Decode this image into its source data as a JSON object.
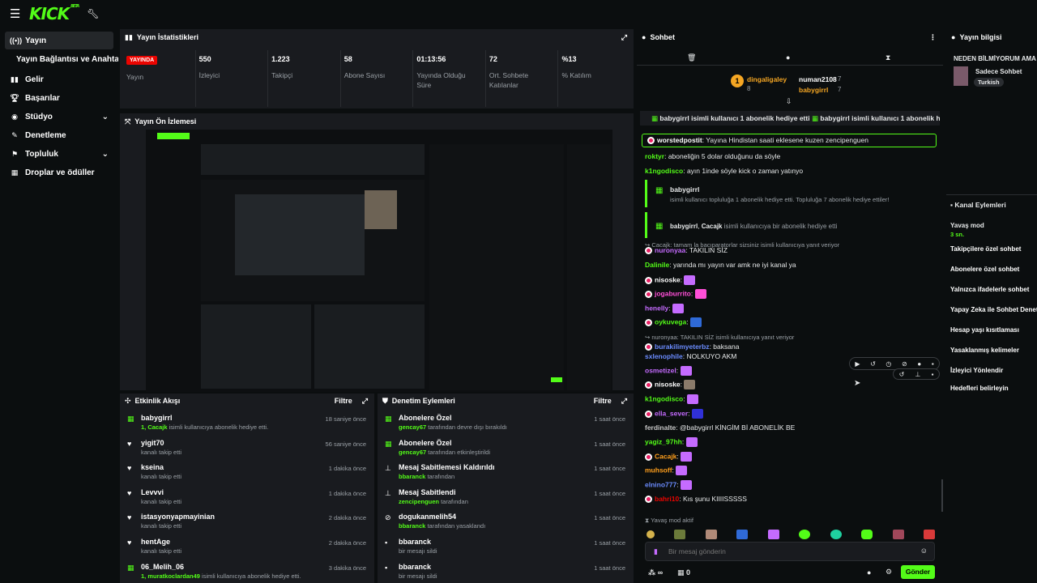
{
  "brand": {
    "logo": "KICK",
    "logo_sup": "BETA"
  },
  "sidebar": {
    "items": [
      {
        "label": "Yayın",
        "icon": "broadcast-icon"
      },
      {
        "label": "Yayın Bağlantısı ve Anahtarı"
      },
      {
        "label": "Gelir",
        "icon": "chart-icon"
      },
      {
        "label": "Başarılar",
        "icon": "trophy-icon"
      },
      {
        "label": "Stüdyo",
        "icon": "studio-icon"
      },
      {
        "label": "Denetleme",
        "icon": "wrench-icon"
      },
      {
        "label": "Topluluk",
        "icon": "community-icon"
      },
      {
        "label": "Droplar ve ödüller",
        "icon": "gift-icon"
      }
    ]
  },
  "stats_panel": {
    "title": "Yayın İstatistikleri",
    "live_label": "YAYINDA",
    "stats": [
      {
        "value": "",
        "label": "Yayın"
      },
      {
        "value": "550",
        "label": "İzleyici"
      },
      {
        "value": "1.223",
        "label": "Takipçi"
      },
      {
        "value": "58",
        "label": "Abone Sayısı"
      },
      {
        "value": "01:13:56",
        "label": "Yayında Olduğu Süre"
      },
      {
        "value": "72",
        "label": "Ort. Sohbete Katılanlar"
      },
      {
        "value": "%13",
        "label": "% Katılım"
      }
    ]
  },
  "preview_panel": {
    "title": "Yayın Ön İzlemesi"
  },
  "activity": {
    "title": "Etkinlik Akışı",
    "filter": "Filtre",
    "rows": [
      {
        "name": "babygirrl",
        "sub_user": "1, Cacajk",
        "sub": " isimli kullanıcıya abonelik hediye etti.",
        "time": "18 saniye önce",
        "icon": "gift"
      },
      {
        "name": "yigit70",
        "sub_user": "",
        "sub": "kanalı takip etti",
        "time": "56 saniye önce",
        "icon": "heart"
      },
      {
        "name": "kseina",
        "sub_user": "",
        "sub": "kanalı takip etti",
        "time": "1 dakika önce",
        "icon": "heart"
      },
      {
        "name": "Levvvi",
        "sub_user": "",
        "sub": "kanalı takip etti",
        "time": "1 dakika önce",
        "icon": "heart"
      },
      {
        "name": "istasyonyapmayinian",
        "sub_user": "",
        "sub": "kanalı takip etti",
        "time": "2 dakika önce",
        "icon": "heart"
      },
      {
        "name": "hentAge",
        "sub_user": "",
        "sub": "kanalı takip etti",
        "time": "2 dakika önce",
        "icon": "heart"
      },
      {
        "name": "06_Melih_06",
        "sub_user": "1, muratkoclardan49",
        "sub": " isimli kullanıcıya abonelik hediye etti.",
        "time": "3 dakika önce",
        "icon": "gift"
      }
    ]
  },
  "moderation": {
    "title": "Denetim Eylemleri",
    "filter": "Filtre",
    "rows": [
      {
        "name": "Abonelere Özel",
        "sub_user": "gencay67",
        "sub": " tarafından devre dışı bırakıldı",
        "time": "1 saat önce",
        "icon": "gift"
      },
      {
        "name": "Abonelere Özel",
        "sub_user": "gencay67",
        "sub": " tarafından etkinleştirildi",
        "time": "1 saat önce",
        "icon": "gift"
      },
      {
        "name": "Mesaj Sabitlemesi Kaldırıldı",
        "sub_user": "bbaranck",
        "sub": " tarafından",
        "time": "1 saat önce",
        "icon": "pin"
      },
      {
        "name": "Mesaj Sabitlendi",
        "sub_user": "zencipenguen",
        "sub": " tarafından",
        "time": "1 saat önce",
        "icon": "pin"
      },
      {
        "name": "dogukanmelih54",
        "sub_user": "bbaranck",
        "sub": " tarafından yasaklandı",
        "time": "1 saat önce",
        "icon": "ban"
      },
      {
        "name": "bbaranck",
        "sub_user": "",
        "sub": "bir mesajı sildi",
        "time": "1 saat önce",
        "icon": "trash"
      },
      {
        "name": "bbaranck",
        "sub_user": "",
        "sub": "bir mesajı sildi",
        "time": "1 saat önce",
        "icon": "trash"
      }
    ]
  },
  "chat": {
    "title": "Sohbet",
    "leaders": [
      {
        "name": "dingaligaley",
        "count": "8"
      },
      {
        "name": "numan2108",
        "count": "7"
      },
      {
        "name": "babygirrl",
        "count": "7"
      }
    ],
    "ticker": "babygirrl isimli kullanıcı 1 abonelik hediye etti  babygirrl isimli kullanıcı 1 abonelik hediye etti",
    "ticker_user": "babygirrl",
    "ticker_text": " isimli kullanıcı 1 abonelik hediye etti",
    "pinned_user": "worstedpostit",
    "pinned_text": ": Yayına Hindistan saati eklesene kuzen zencipenguen",
    "messages": [
      {
        "user": "roktyr",
        "color": "#53fc18",
        "text": ": aboneliğin 5 dolar olduğunu da söyle"
      },
      {
        "user": "k1ngodisco",
        "color": "#53fc18",
        "text": ": ayın 1inde söyle kick o zaman yatınyo"
      }
    ],
    "gift1_user": "babygirrl",
    "gift1_text": "isimli kullanıcı topluluğa 1 abonelik hediye etti. Topluluğa 7 abonelik hediye ettiler!",
    "gift2_text": "babygirrl, Cacajk isimli kullanıcıya bir abonelik hediye etti",
    "gift2_a": "babygirrl",
    "gift2_b": "Cacajk",
    "gift2_rest": " isimli kullanıcıya bir abonelik hediye etti",
    "reply1": "Cacajk: tamam la bacıparatorlar sizsiniz isimli kullanıcıya yanıt veriyor",
    "lines": [
      {
        "user": "nuronyaa",
        "color": "#c56bff",
        "text": ": TAKILIN SİZ",
        "badge": true
      },
      {
        "user": "Dalinile",
        "color": "#53fc18",
        "text": ": yarında mı yayın var amk ne iyi kanal ya"
      },
      {
        "user": "nisoske",
        "color": "#fff",
        "text": ":",
        "badge": true
      },
      {
        "user": "jogaburrito",
        "color": "#ff4fd8",
        "text": ":",
        "badge": true
      },
      {
        "user": "henelly",
        "color": "#c56bff",
        "text": ":"
      },
      {
        "user": "oykuvega",
        "color": "#53fc18",
        "text": ":",
        "badge": true
      },
      {
        "user": "sxlenophile",
        "color": "#6b8cff",
        "text": ": NOLKUYO AKM"
      },
      {
        "user": "osmetizel",
        "color": "#c56bff",
        "text": ":"
      },
      {
        "user": "nisoske",
        "color": "#fff",
        "text": ":",
        "badge": true
      },
      {
        "user": "k1ngodisco",
        "color": "#53fc18",
        "text": ":"
      },
      {
        "user": "ella_sever",
        "color": "#c56bff",
        "text": ":",
        "badge": true
      },
      {
        "user": "ferdinalte",
        "color": "#c7c7c7",
        "text": ": @babygirrl KİNGİM Bİ ABONELİK BE"
      },
      {
        "user": "yagiz_97hh",
        "color": "#53fc18",
        "text": ":"
      },
      {
        "user": "Cacajk",
        "color": "#ff9f1c",
        "text": ":",
        "badge": true
      },
      {
        "user": "muhsoff",
        "color": "#ff9f1c",
        "text": ":"
      },
      {
        "user": "elnino777",
        "color": "#6b8cff",
        "text": ":"
      },
      {
        "user": "bahri10",
        "color": "#eb0400",
        "text": ": Kıs şunu KIIIISSSSS",
        "badge": true
      }
    ],
    "reply2": "nuronyaa: TAKILIN SİZ isimli kullanıcıya yanıt veriyor",
    "reply2_user": "burakilimyeterbz",
    "reply2_text": ": baksana",
    "slow_mode": "Yavaş mod aktif",
    "input_placeholder": "Bir mesaj gönderin",
    "send": "Gönder",
    "count_infinity": "∞",
    "count_zero": "0"
  },
  "info": {
    "title": "Yayın bilgisi",
    "stream_title": "NEDEN BİLMİYORUM AMA",
    "category": "Sadece Sohbet",
    "language": "Turkish",
    "actions_title": "Kanal Eylemleri",
    "slow_mode": "Yavaş mod",
    "slow_mode_value": "3 sn.",
    "actions": [
      "Takipçilere özel sohbet",
      "Abonelere özel sohbet",
      "Yalnızca ifadelerle sohbet",
      "Yapay Zeka ile Sohbet Denetimi",
      "Hesap yaşı kısıtlaması",
      "Yasaklanmış kelimeler",
      "İzleyici Yönlendir",
      "Hedefleri belirleyin"
    ]
  },
  "colors": {
    "accent": "#53fc18",
    "live": "#eb0400",
    "panel": "#191b1f",
    "bg": "#0b0e0f"
  }
}
